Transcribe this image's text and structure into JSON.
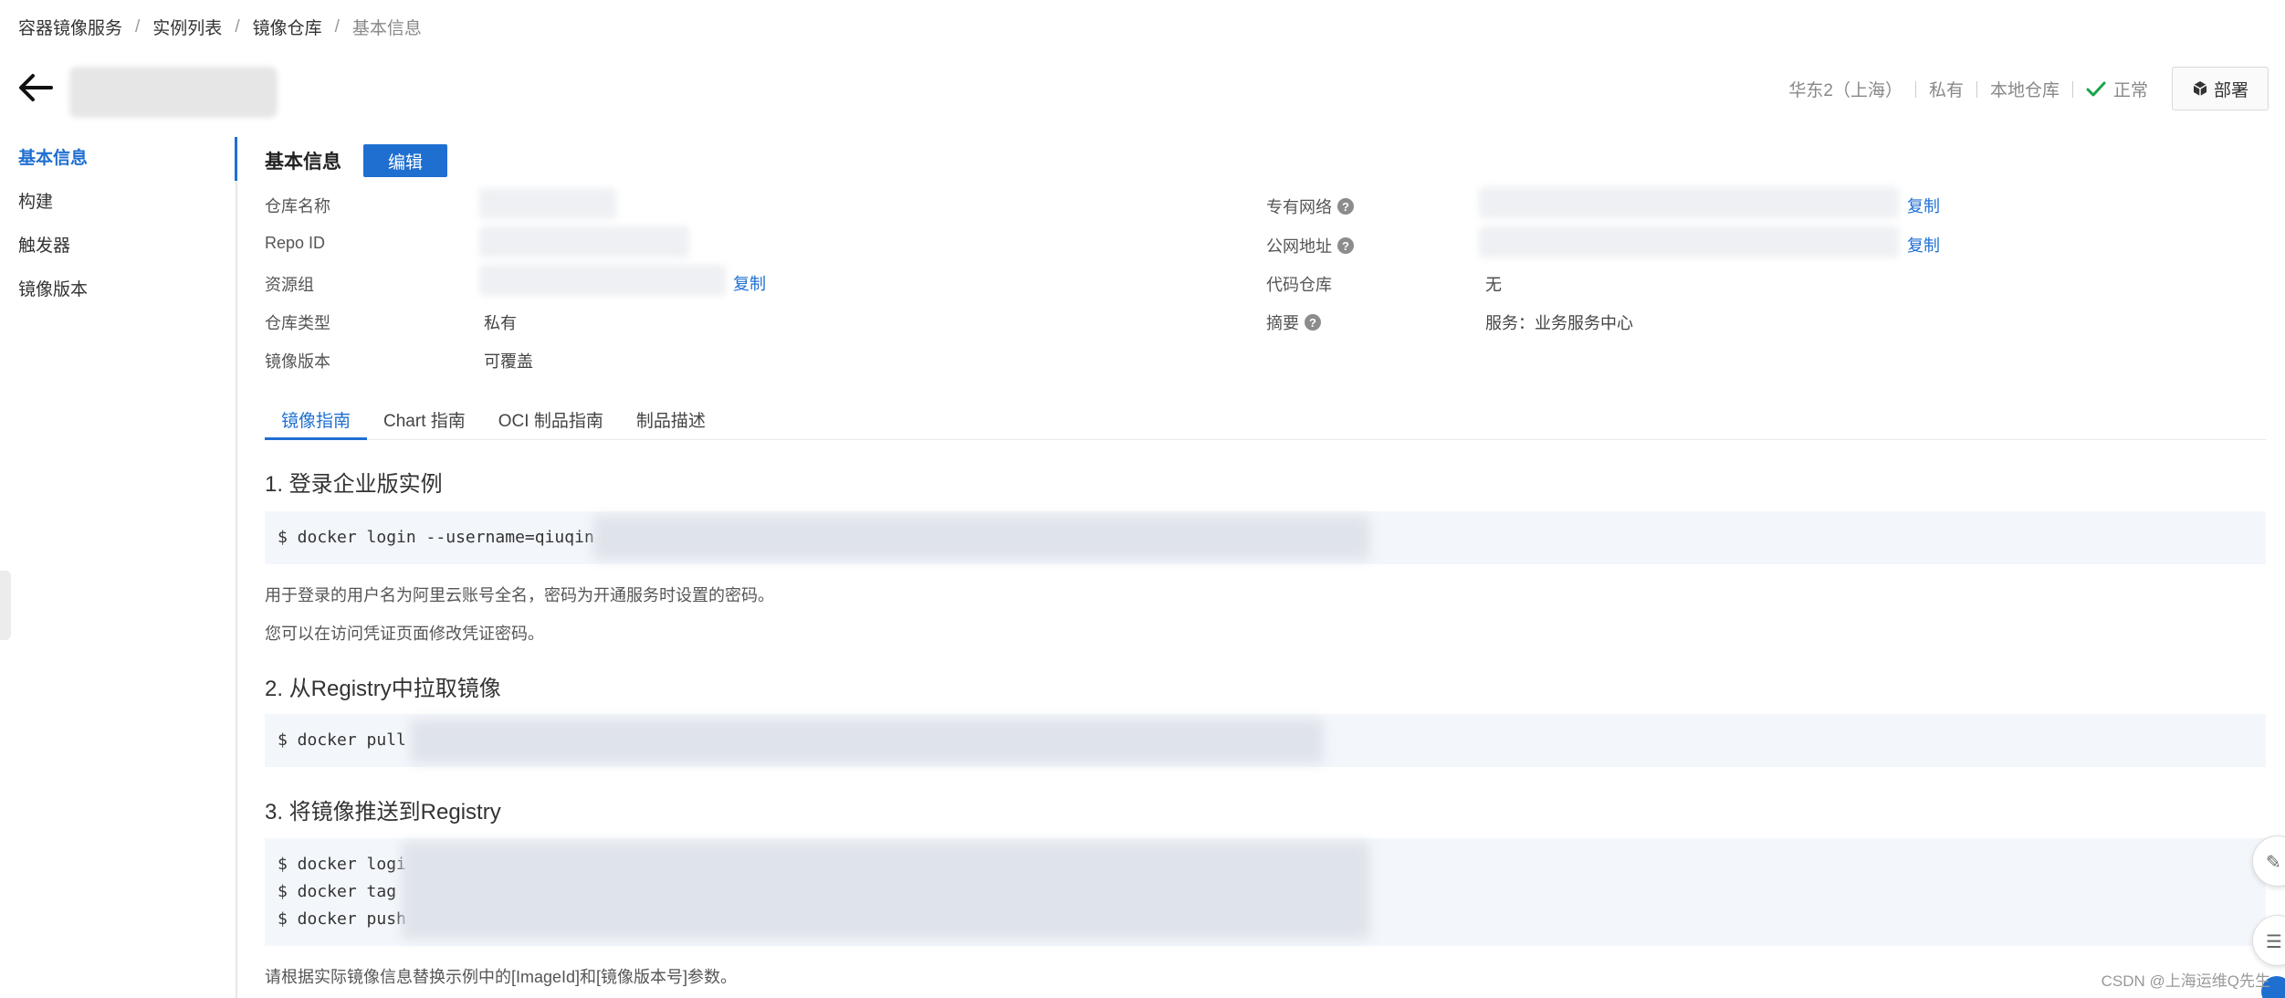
{
  "breadcrumb": [
    "容器镜像服务",
    "实例列表",
    "镜像仓库",
    "基本信息"
  ],
  "header": {
    "region": "华东2（上海）",
    "visibility": "私有",
    "source": "本地仓库",
    "status": "正常",
    "deploy_label": "部署"
  },
  "sidebar": {
    "items": [
      {
        "label": "基本信息",
        "active": true
      },
      {
        "label": "构建"
      },
      {
        "label": "触发器"
      },
      {
        "label": "镜像版本"
      }
    ]
  },
  "basic_info": {
    "title": "基本信息",
    "edit_label": "编辑",
    "left": {
      "repo_name_label": "仓库名称",
      "repo_id_label": "Repo ID",
      "resource_group_label": "资源组",
      "repo_type_label": "仓库类型",
      "repo_type_value": "私有",
      "image_version_label": "镜像版本",
      "image_version_value": "可覆盖"
    },
    "right": {
      "vpc_label": "专有网络",
      "public_label": "公网地址",
      "code_repo_label": "代码仓库",
      "code_repo_value": "无",
      "summary_label": "摘要",
      "summary_value": "服务：业务服务中心"
    },
    "copy_label": "复制"
  },
  "tabs": [
    "镜像指南",
    "Chart 指南",
    "OCI 制品指南",
    "制品描述"
  ],
  "guide": {
    "step1_title": "1. 登录企业版实例",
    "step1_code": "$ docker login --username=qiuqin",
    "step1_note1": "用于登录的用户名为阿里云账号全名，密码为开通服务时设置的密码。",
    "step1_note2": "您可以在访问凭证页面修改凭证密码。",
    "step2_title": "2. 从Registry中拉取镜像",
    "step2_code": "$ docker pull ",
    "step3_title": "3. 将镜像推送到Registry",
    "step3_code": [
      "$ docker logi",
      "$ docker tag ",
      "$ docker push"
    ],
    "step3_note": "请根据实际镜像信息替换示例中的[ImageId]和[镜像版本号]参数。"
  },
  "watermark": "CSDN @上海运维Q先生"
}
